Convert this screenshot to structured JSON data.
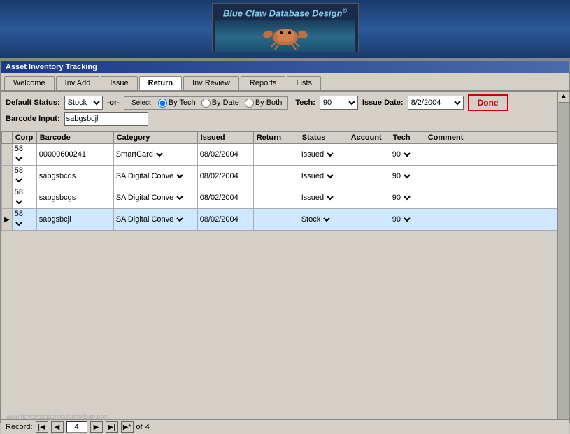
{
  "app": {
    "title": "Asset Inventory Tracking",
    "logo_text": "Blue Claw Database Design",
    "reg_symbol": "®"
  },
  "tabs": [
    {
      "label": "Welcome",
      "active": false
    },
    {
      "label": "Inv Add",
      "active": false
    },
    {
      "label": "Issue",
      "active": false
    },
    {
      "label": "Return",
      "active": true
    },
    {
      "label": "Inv Review",
      "active": false
    },
    {
      "label": "Reports",
      "active": false
    },
    {
      "label": "Lists",
      "active": false
    }
  ],
  "toolbar": {
    "default_status_label": "Default Status:",
    "default_status_value": "Stock",
    "barcode_label": "Barcode Input:",
    "barcode_value": "sabgsbcjl",
    "or_label": "-or-",
    "select_group_title": "Select",
    "by_tech_label": "By Tech",
    "by_date_label": "By Date",
    "by_both_label": "By Both",
    "tech_label": "Tech:",
    "tech_value": "90",
    "issue_date_label": "Issue Date:",
    "issue_date_value": "8/2/2004",
    "done_label": "Done"
  },
  "table": {
    "columns": [
      "Corp",
      "Barcode",
      "Category",
      "Issued",
      "Return",
      "Status",
      "Account",
      "Tech",
      "Comment"
    ],
    "rows": [
      {
        "corp": "58",
        "barcode": "00000600241",
        "category": "SmartCard",
        "issued": "08/02/2004",
        "return_val": "",
        "status": "Issued",
        "account": "",
        "tech": "90",
        "comment": ""
      },
      {
        "corp": "58",
        "barcode": "sabgsbcds",
        "category": "SA Digital Conve",
        "issued": "08/02/2004",
        "return_val": "",
        "status": "Issued",
        "account": "",
        "tech": "90",
        "comment": ""
      },
      {
        "corp": "58",
        "barcode": "sabgsbcgs",
        "category": "SA Digital Conve",
        "issued": "08/02/2004",
        "return_val": "",
        "status": "Issued",
        "account": "",
        "tech": "90",
        "comment": ""
      },
      {
        "corp": "58",
        "barcode": "sabgsbcjl",
        "category": "SA Digital Conve",
        "issued": "08/02/2004",
        "return_val": "",
        "status": "Stock",
        "account": "",
        "tech": "90",
        "comment": ""
      }
    ]
  },
  "record_nav": {
    "label": "Record:",
    "current": "4",
    "total": "4",
    "of_label": "of"
  },
  "watermark": "www.havensapachriatiancollege.com"
}
